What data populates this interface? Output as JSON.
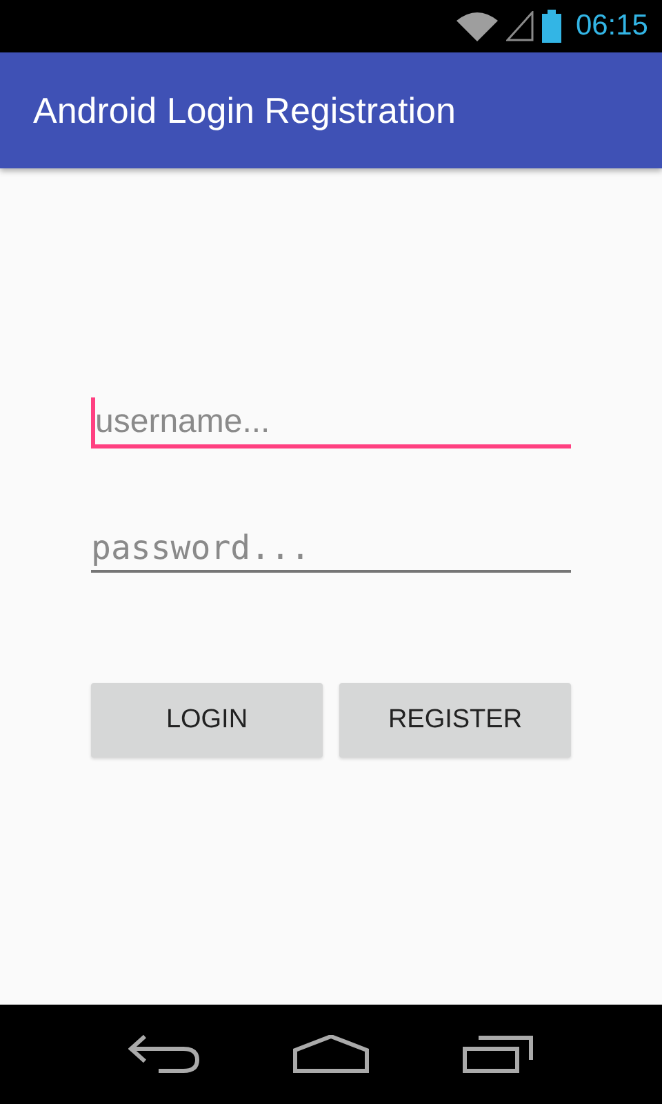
{
  "status_bar": {
    "time": "06:15"
  },
  "app_bar": {
    "title": "Android Login Registration"
  },
  "fields": [
    {
      "kind": "text",
      "placeholder": "username...",
      "focused": true
    },
    {
      "kind": "password",
      "placeholder": "password...",
      "focused": false
    }
  ],
  "buttons": [
    "LOGIN",
    "REGISTER"
  ]
}
